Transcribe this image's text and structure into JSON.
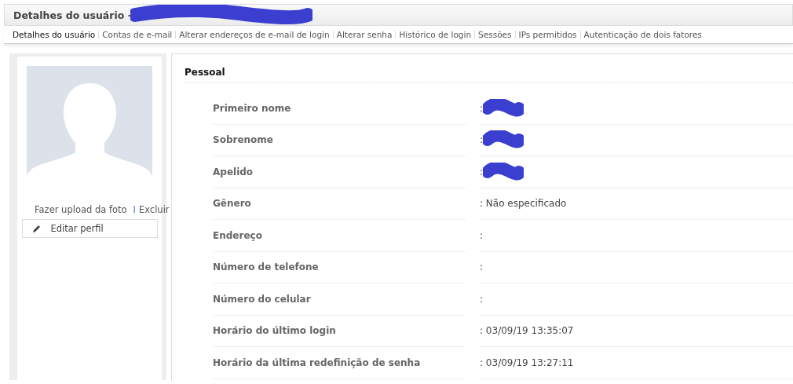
{
  "window": {
    "title": "Detalhes do usuário -",
    "title_redacted": true
  },
  "tabs": [
    {
      "label": "Detalhes do usuário",
      "selected": true
    },
    {
      "label": "Contas de e-mail",
      "selected": false
    },
    {
      "label": "Alterar endereços de e-mail de login",
      "selected": false
    },
    {
      "label": "Alterar senha",
      "selected": false
    },
    {
      "label": "Histórico de login",
      "selected": false
    },
    {
      "label": "Sessões",
      "selected": false
    },
    {
      "label": "IPs permitidos",
      "selected": false
    },
    {
      "label": "Autenticação de dois fatores",
      "selected": false
    }
  ],
  "sidebar": {
    "upload_link": "Fazer upload da foto",
    "separator": "I",
    "delete_link": "Excluir",
    "edit_button": "Editar perfil"
  },
  "section": {
    "title": "Pessoal",
    "rows": [
      {
        "label": "Primeiro nome",
        "value": ":",
        "redacted": true
      },
      {
        "label": "Sobrenome",
        "value": ":",
        "redacted": true
      },
      {
        "label": "Apelido",
        "value": ":",
        "redacted": true
      },
      {
        "label": "Gênero",
        "value": ": Não especificado",
        "redacted": false
      },
      {
        "label": "Endereço",
        "value": ":",
        "redacted": false
      },
      {
        "label": "Número de telefone",
        "value": ":",
        "redacted": false
      },
      {
        "label": "Número do celular",
        "value": ":",
        "redacted": false
      },
      {
        "label": "Horário do último login",
        "value": ": 03/09/19 13:35:07",
        "redacted": false
      },
      {
        "label": "Horário da última redefinição de senha",
        "value": ": 03/09/19 13:27:11",
        "redacted": false
      }
    ]
  }
}
